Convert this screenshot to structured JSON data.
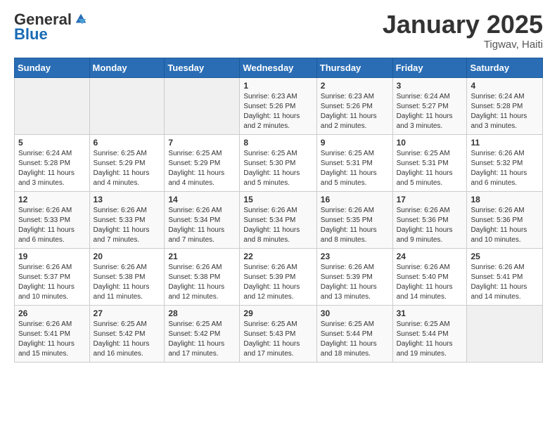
{
  "logo": {
    "general": "General",
    "blue": "Blue"
  },
  "header": {
    "title": "January 2025",
    "subtitle": "Tigwav, Haiti"
  },
  "days_of_week": [
    "Sunday",
    "Monday",
    "Tuesday",
    "Wednesday",
    "Thursday",
    "Friday",
    "Saturday"
  ],
  "weeks": [
    [
      {
        "day": "",
        "sunrise": "",
        "sunset": "",
        "daylight": ""
      },
      {
        "day": "",
        "sunrise": "",
        "sunset": "",
        "daylight": ""
      },
      {
        "day": "",
        "sunrise": "",
        "sunset": "",
        "daylight": ""
      },
      {
        "day": "1",
        "sunrise": "Sunrise: 6:23 AM",
        "sunset": "Sunset: 5:26 PM",
        "daylight": "Daylight: 11 hours and 2 minutes."
      },
      {
        "day": "2",
        "sunrise": "Sunrise: 6:23 AM",
        "sunset": "Sunset: 5:26 PM",
        "daylight": "Daylight: 11 hours and 2 minutes."
      },
      {
        "day": "3",
        "sunrise": "Sunrise: 6:24 AM",
        "sunset": "Sunset: 5:27 PM",
        "daylight": "Daylight: 11 hours and 3 minutes."
      },
      {
        "day": "4",
        "sunrise": "Sunrise: 6:24 AM",
        "sunset": "Sunset: 5:28 PM",
        "daylight": "Daylight: 11 hours and 3 minutes."
      }
    ],
    [
      {
        "day": "5",
        "sunrise": "Sunrise: 6:24 AM",
        "sunset": "Sunset: 5:28 PM",
        "daylight": "Daylight: 11 hours and 3 minutes."
      },
      {
        "day": "6",
        "sunrise": "Sunrise: 6:25 AM",
        "sunset": "Sunset: 5:29 PM",
        "daylight": "Daylight: 11 hours and 4 minutes."
      },
      {
        "day": "7",
        "sunrise": "Sunrise: 6:25 AM",
        "sunset": "Sunset: 5:29 PM",
        "daylight": "Daylight: 11 hours and 4 minutes."
      },
      {
        "day": "8",
        "sunrise": "Sunrise: 6:25 AM",
        "sunset": "Sunset: 5:30 PM",
        "daylight": "Daylight: 11 hours and 5 minutes."
      },
      {
        "day": "9",
        "sunrise": "Sunrise: 6:25 AM",
        "sunset": "Sunset: 5:31 PM",
        "daylight": "Daylight: 11 hours and 5 minutes."
      },
      {
        "day": "10",
        "sunrise": "Sunrise: 6:25 AM",
        "sunset": "Sunset: 5:31 PM",
        "daylight": "Daylight: 11 hours and 5 minutes."
      },
      {
        "day": "11",
        "sunrise": "Sunrise: 6:26 AM",
        "sunset": "Sunset: 5:32 PM",
        "daylight": "Daylight: 11 hours and 6 minutes."
      }
    ],
    [
      {
        "day": "12",
        "sunrise": "Sunrise: 6:26 AM",
        "sunset": "Sunset: 5:33 PM",
        "daylight": "Daylight: 11 hours and 6 minutes."
      },
      {
        "day": "13",
        "sunrise": "Sunrise: 6:26 AM",
        "sunset": "Sunset: 5:33 PM",
        "daylight": "Daylight: 11 hours and 7 minutes."
      },
      {
        "day": "14",
        "sunrise": "Sunrise: 6:26 AM",
        "sunset": "Sunset: 5:34 PM",
        "daylight": "Daylight: 11 hours and 7 minutes."
      },
      {
        "day": "15",
        "sunrise": "Sunrise: 6:26 AM",
        "sunset": "Sunset: 5:34 PM",
        "daylight": "Daylight: 11 hours and 8 minutes."
      },
      {
        "day": "16",
        "sunrise": "Sunrise: 6:26 AM",
        "sunset": "Sunset: 5:35 PM",
        "daylight": "Daylight: 11 hours and 8 minutes."
      },
      {
        "day": "17",
        "sunrise": "Sunrise: 6:26 AM",
        "sunset": "Sunset: 5:36 PM",
        "daylight": "Daylight: 11 hours and 9 minutes."
      },
      {
        "day": "18",
        "sunrise": "Sunrise: 6:26 AM",
        "sunset": "Sunset: 5:36 PM",
        "daylight": "Daylight: 11 hours and 10 minutes."
      }
    ],
    [
      {
        "day": "19",
        "sunrise": "Sunrise: 6:26 AM",
        "sunset": "Sunset: 5:37 PM",
        "daylight": "Daylight: 11 hours and 10 minutes."
      },
      {
        "day": "20",
        "sunrise": "Sunrise: 6:26 AM",
        "sunset": "Sunset: 5:38 PM",
        "daylight": "Daylight: 11 hours and 11 minutes."
      },
      {
        "day": "21",
        "sunrise": "Sunrise: 6:26 AM",
        "sunset": "Sunset: 5:38 PM",
        "daylight": "Daylight: 11 hours and 12 minutes."
      },
      {
        "day": "22",
        "sunrise": "Sunrise: 6:26 AM",
        "sunset": "Sunset: 5:39 PM",
        "daylight": "Daylight: 11 hours and 12 minutes."
      },
      {
        "day": "23",
        "sunrise": "Sunrise: 6:26 AM",
        "sunset": "Sunset: 5:39 PM",
        "daylight": "Daylight: 11 hours and 13 minutes."
      },
      {
        "day": "24",
        "sunrise": "Sunrise: 6:26 AM",
        "sunset": "Sunset: 5:40 PM",
        "daylight": "Daylight: 11 hours and 14 minutes."
      },
      {
        "day": "25",
        "sunrise": "Sunrise: 6:26 AM",
        "sunset": "Sunset: 5:41 PM",
        "daylight": "Daylight: 11 hours and 14 minutes."
      }
    ],
    [
      {
        "day": "26",
        "sunrise": "Sunrise: 6:26 AM",
        "sunset": "Sunset: 5:41 PM",
        "daylight": "Daylight: 11 hours and 15 minutes."
      },
      {
        "day": "27",
        "sunrise": "Sunrise: 6:25 AM",
        "sunset": "Sunset: 5:42 PM",
        "daylight": "Daylight: 11 hours and 16 minutes."
      },
      {
        "day": "28",
        "sunrise": "Sunrise: 6:25 AM",
        "sunset": "Sunset: 5:42 PM",
        "daylight": "Daylight: 11 hours and 17 minutes."
      },
      {
        "day": "29",
        "sunrise": "Sunrise: 6:25 AM",
        "sunset": "Sunset: 5:43 PM",
        "daylight": "Daylight: 11 hours and 17 minutes."
      },
      {
        "day": "30",
        "sunrise": "Sunrise: 6:25 AM",
        "sunset": "Sunset: 5:44 PM",
        "daylight": "Daylight: 11 hours and 18 minutes."
      },
      {
        "day": "31",
        "sunrise": "Sunrise: 6:25 AM",
        "sunset": "Sunset: 5:44 PM",
        "daylight": "Daylight: 11 hours and 19 minutes."
      },
      {
        "day": "",
        "sunrise": "",
        "sunset": "",
        "daylight": ""
      }
    ]
  ]
}
